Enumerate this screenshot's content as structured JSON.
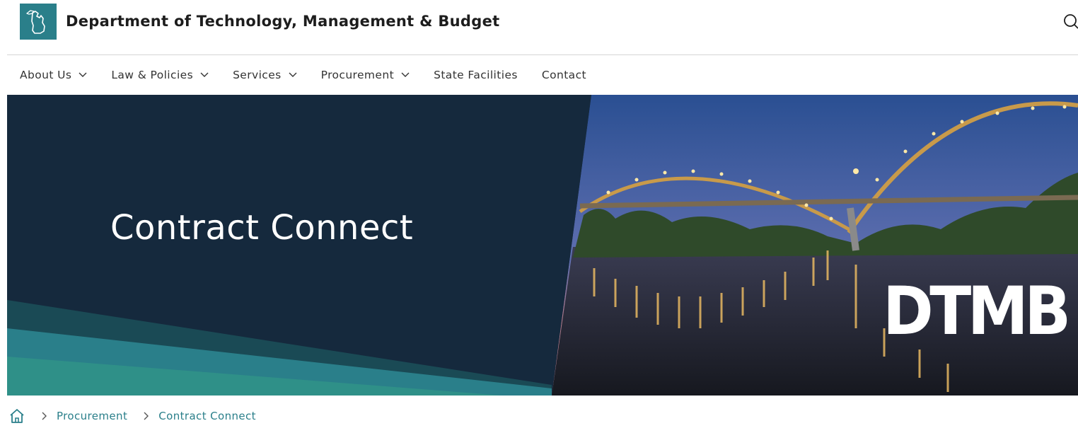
{
  "header": {
    "site_title": "Department of Technology, Management & Budget",
    "logo_icon": "michigan-state-icon",
    "search_icon": "search-icon",
    "brand_color": "#2a7f8a"
  },
  "nav": {
    "items": [
      {
        "label": "About Us",
        "has_dropdown": true
      },
      {
        "label": "Law & Policies",
        "has_dropdown": true
      },
      {
        "label": "Services",
        "has_dropdown": true
      },
      {
        "label": "Procurement",
        "has_dropdown": true
      },
      {
        "label": "State Facilities",
        "has_dropdown": false
      },
      {
        "label": "Contact",
        "has_dropdown": false
      }
    ]
  },
  "hero": {
    "title": "Contract Connect",
    "wordmark": "DTMB",
    "panel_color": "#15293d",
    "accent_color": "#2a7f8a"
  },
  "breadcrumb": {
    "home_icon": "home-icon",
    "items": [
      {
        "label": "Procurement"
      },
      {
        "label": "Contract Connect"
      }
    ],
    "link_color": "#2a7f8a"
  }
}
